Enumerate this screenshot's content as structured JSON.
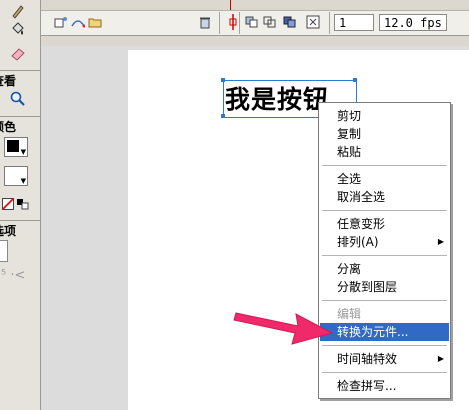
{
  "tools_panel": {
    "sections": [
      {
        "label": "查看"
      },
      {
        "label": "颜色"
      },
      {
        "label": "选项"
      }
    ],
    "icons": [
      "pencil-icon",
      "paint-bucket-icon",
      "eraser-icon",
      "zoom-icon"
    ],
    "stroke_color": "#000000",
    "fill_color": "#ffffff"
  },
  "timeline": {
    "frame": "1",
    "fps": "12.0 fps"
  },
  "canvas": {
    "text": "我是按钮"
  },
  "context_menu": {
    "items": [
      {
        "label": "剪切"
      },
      {
        "label": "复制"
      },
      {
        "label": "粘贴"
      },
      {
        "label": "全选"
      },
      {
        "label": "取消全选"
      },
      {
        "label": "任意变形"
      },
      {
        "label": "排列(A)"
      },
      {
        "label": "分离"
      },
      {
        "label": "分散到图层"
      },
      {
        "label": "编辑"
      },
      {
        "label": "转换为元件..."
      },
      {
        "label": "时间轴特效"
      },
      {
        "label": "检查拼写..."
      }
    ]
  },
  "colors": {
    "accent": "#316ac5",
    "arrow": "#f02a6a",
    "selection": "#2b7bd6"
  }
}
